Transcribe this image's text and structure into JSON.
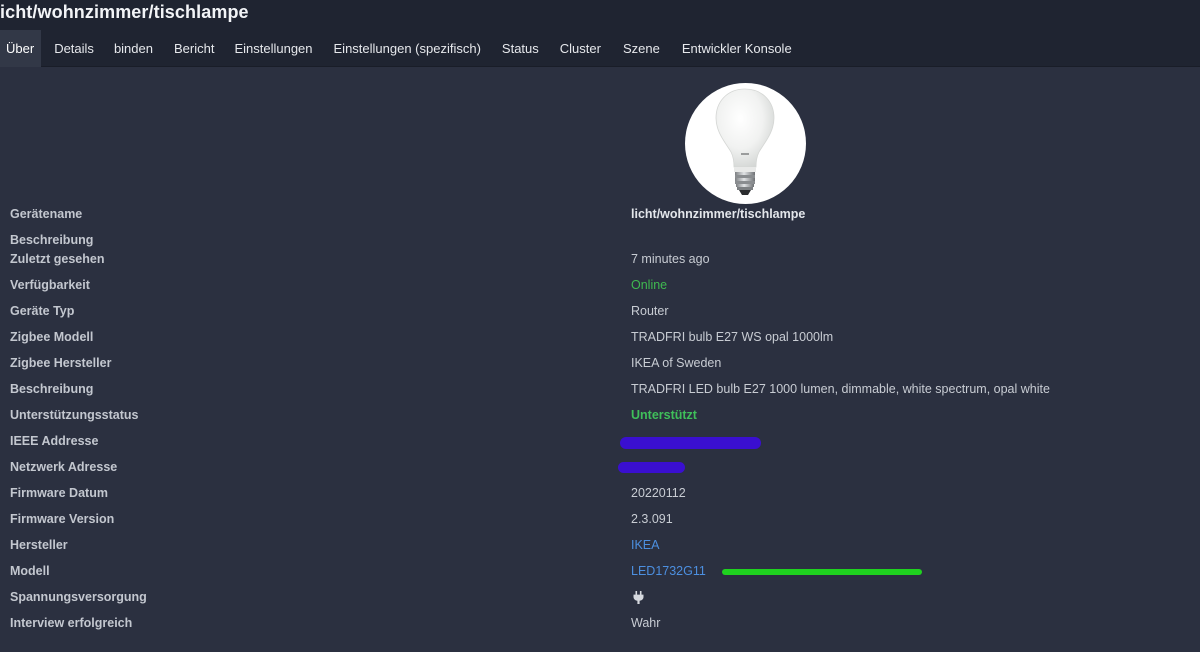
{
  "header": {
    "title": "icht/wohnzimmer/tischlampe",
    "tabs": [
      {
        "label": "Über",
        "active": true
      },
      {
        "label": "Details"
      },
      {
        "label": "binden"
      },
      {
        "label": "Bericht"
      },
      {
        "label": "Einstellungen"
      },
      {
        "label": "Einstellungen (spezifisch)"
      },
      {
        "label": "Status"
      },
      {
        "label": "Cluster"
      },
      {
        "label": "Szene"
      },
      {
        "label": "Entwickler Konsole"
      }
    ]
  },
  "device": {
    "image_icon": "lightbulb-image",
    "rows": [
      {
        "label": "Gerätename",
        "value": "licht/wohnzimmer/tischlampe"
      },
      {
        "label": "Beschreibung",
        "value": ""
      },
      {
        "label": "Zuletzt gesehen",
        "value": "7 minutes ago"
      },
      {
        "label": "Verfügbarkeit",
        "value": "Online"
      },
      {
        "label": "Geräte Typ",
        "value": "Router"
      },
      {
        "label": "Zigbee Modell",
        "value": "TRADFRI bulb E27 WS opal 1000lm"
      },
      {
        "label": "Zigbee Hersteller",
        "value": "IKEA of Sweden"
      },
      {
        "label": "Beschreibung",
        "value": "TRADFRI LED bulb E27 1000 lumen, dimmable, white spectrum, opal white"
      },
      {
        "label": "Unterstützungsstatus",
        "value": "Unterstützt"
      },
      {
        "label": "IEEE Addresse",
        "value": ""
      },
      {
        "label": "Netzwerk Adresse",
        "value": ""
      },
      {
        "label": "Firmware Datum",
        "value": "20220112"
      },
      {
        "label": "Firmware Version",
        "value": "2.3.091"
      },
      {
        "label": "Hersteller",
        "value": "IKEA"
      },
      {
        "label": "Modell",
        "value": "LED1732G11"
      },
      {
        "label": "Spannungsversorgung",
        "value": "",
        "icon": "power-plug-icon"
      },
      {
        "label": "Interview erfolgreich",
        "value": "Wahr"
      }
    ]
  },
  "colors": {
    "online": "#3fb950",
    "link": "#4c8fe0",
    "redaction": "#3a0fd0",
    "highlight": "#1fd21f"
  }
}
